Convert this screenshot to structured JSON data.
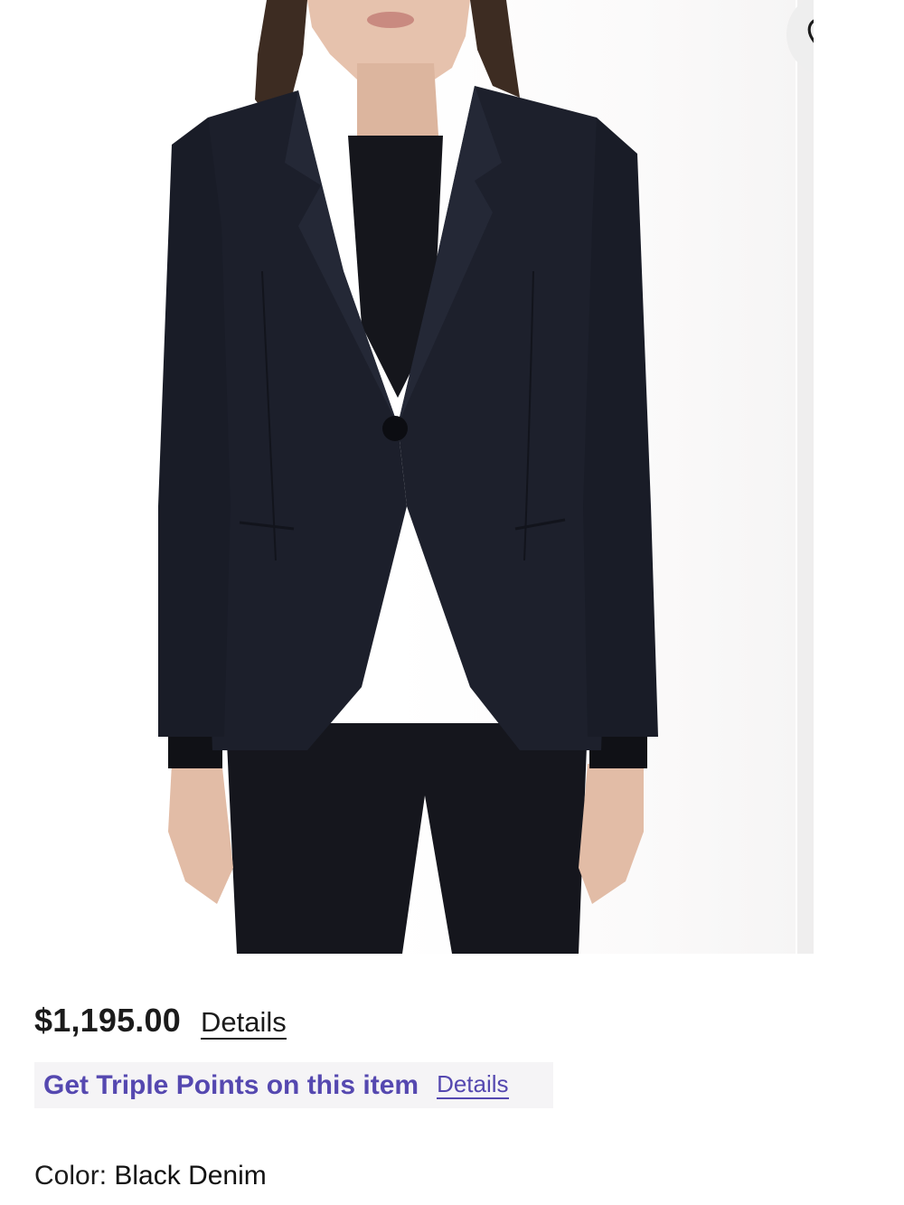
{
  "product": {
    "price": "$1,195.00",
    "price_details_label": "Details",
    "promo_text": "Get Triple Points on this item",
    "promo_details_label": "Details",
    "color_label": "Color:",
    "color_value": "Black Denim"
  },
  "icons": {
    "wishlist": "heart-icon"
  },
  "colors": {
    "promo_accent": "#5548b0",
    "text": "#1b1b1b",
    "jacket": "#1c1f2b"
  }
}
